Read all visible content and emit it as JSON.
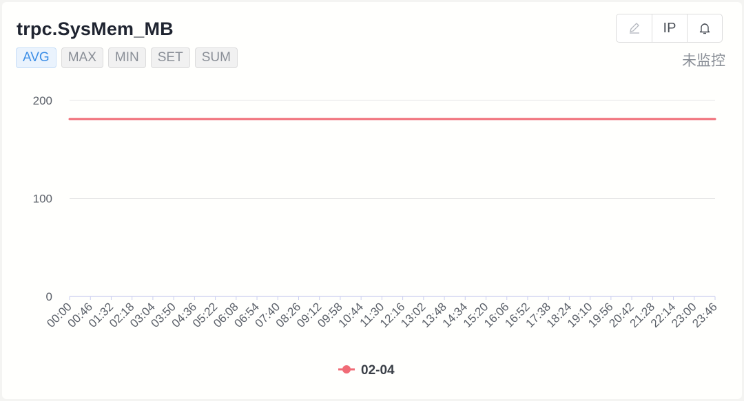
{
  "title": "trpc.SysMem_MB",
  "tabs": [
    {
      "label": "AVG",
      "active": true
    },
    {
      "label": "MAX",
      "active": false
    },
    {
      "label": "MIN",
      "active": false
    },
    {
      "label": "SET",
      "active": false
    },
    {
      "label": "SUM",
      "active": false
    }
  ],
  "tools": {
    "edit_icon": "pencil-icon",
    "ip_label": "IP",
    "alarm_icon": "bell-icon"
  },
  "status": "未监控",
  "colors": {
    "series": "#f06b76",
    "active_tab": "#3c8ee6",
    "grid": "#e6e6e6",
    "axis": "#c9cdf0"
  },
  "chart_data": {
    "type": "line",
    "title": "",
    "xlabel": "",
    "ylabel": "",
    "ylim": [
      0,
      200
    ],
    "yticks": [
      0,
      100,
      200
    ],
    "grid": true,
    "legend_position": "bottom-center",
    "x": [
      "00:00",
      "00:46",
      "01:32",
      "02:18",
      "03:04",
      "03:50",
      "04:36",
      "05:22",
      "06:08",
      "06:54",
      "07:40",
      "08:26",
      "09:12",
      "09:58",
      "10:44",
      "11:30",
      "12:16",
      "13:02",
      "13:48",
      "14:34",
      "15:20",
      "16:06",
      "16:52",
      "17:38",
      "18:24",
      "19:10",
      "19:56",
      "20:42",
      "21:28",
      "22:14",
      "23:00",
      "23:46"
    ],
    "series": [
      {
        "name": "02-04",
        "color": "#f06b76",
        "values": [
          181,
          181,
          181,
          181,
          181,
          181,
          181,
          181,
          181,
          181,
          181,
          181,
          181,
          181,
          181,
          181,
          181,
          181,
          181,
          181,
          181,
          181,
          181,
          181,
          181,
          181,
          181,
          181,
          181,
          181,
          181,
          181
        ]
      }
    ]
  }
}
